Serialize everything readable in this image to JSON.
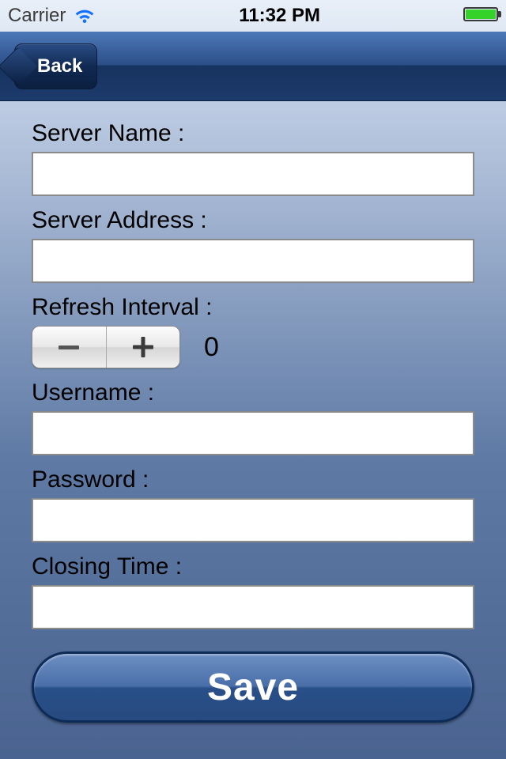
{
  "statusbar": {
    "carrier": "Carrier",
    "time": "11:32 PM"
  },
  "nav": {
    "back": "Back"
  },
  "form": {
    "server_name": {
      "label": "Server Name :",
      "value": ""
    },
    "server_address": {
      "label": "Server Address :",
      "value": ""
    },
    "refresh": {
      "label": "Refresh Interval :",
      "value": "0"
    },
    "username": {
      "label": "Username :",
      "value": ""
    },
    "password": {
      "label": "Password :",
      "value": ""
    },
    "closing_time": {
      "label": "Closing Time :",
      "value": ""
    }
  },
  "actions": {
    "save": "Save"
  }
}
